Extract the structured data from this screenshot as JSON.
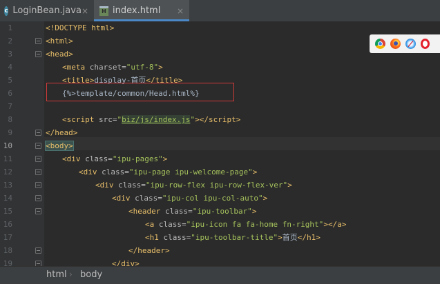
{
  "tabs": [
    {
      "label": "LoginBean.java",
      "icon": "java-class-icon",
      "active": false
    },
    {
      "label": "index.html",
      "icon": "html-file-icon",
      "active": true
    }
  ],
  "tab_close_glyph": "×",
  "editor": {
    "current_line": 10,
    "lines": [
      {
        "num": "1",
        "parts": [
          "<!DOCTYPE html>"
        ]
      },
      {
        "num": "2",
        "parts": [
          "<",
          "html",
          ">"
        ]
      },
      {
        "num": "3",
        "parts": [
          "<",
          "head",
          ">"
        ]
      },
      {
        "num": "4",
        "parts": [
          "<",
          "meta ",
          "charset=",
          "\"utf-8\"",
          ">"
        ]
      },
      {
        "num": "5",
        "parts": [
          "<",
          "title",
          ">",
          "display-首页",
          "</",
          "title",
          ">"
        ]
      },
      {
        "num": "6",
        "parts": [
          "{%>template/common/Head.html%}"
        ]
      },
      {
        "num": "7",
        "parts": [
          ""
        ]
      },
      {
        "num": "8",
        "parts": [
          "<",
          "script ",
          "src=",
          "\"",
          "biz/js/index.js",
          "\"",
          ">",
          "</",
          "script",
          ">"
        ]
      },
      {
        "num": "9",
        "parts": [
          "</",
          "head",
          ">"
        ]
      },
      {
        "num": "10",
        "parts": [
          "<",
          "body",
          ">"
        ]
      },
      {
        "num": "11",
        "parts": [
          "<",
          "div ",
          "class=",
          "\"ipu-pages\"",
          ">"
        ]
      },
      {
        "num": "12",
        "parts": [
          "<",
          "div ",
          "class=",
          "\"ipu-page ipu-welcome-page\"",
          ">"
        ]
      },
      {
        "num": "13",
        "parts": [
          "<",
          "div ",
          "class=",
          "\"ipu-row-flex ipu-row-flex-ver\"",
          ">"
        ]
      },
      {
        "num": "14",
        "parts": [
          "<",
          "div ",
          "class=",
          "\"ipu-col ipu-col-auto\"",
          ">"
        ]
      },
      {
        "num": "15",
        "parts": [
          "<",
          "header ",
          "class=",
          "\"ipu-toolbar\"",
          ">"
        ]
      },
      {
        "num": "16",
        "parts": [
          "<",
          "a ",
          "class=",
          "\"ipu-icon fa fa-home fn-right\"",
          ">",
          "</",
          "a",
          ">"
        ]
      },
      {
        "num": "17",
        "parts": [
          "<",
          "h1 ",
          "class=",
          "\"ipu-toolbar-title\"",
          ">",
          "首页",
          "</",
          "h1",
          ">"
        ]
      },
      {
        "num": "18",
        "parts": [
          "</",
          "header",
          ">"
        ]
      },
      {
        "num": "19",
        "parts": [
          "</",
          "div",
          ">"
        ]
      }
    ]
  },
  "browser_icons": [
    "chrome-icon",
    "firefox-icon",
    "safari-icon",
    "opera-icon"
  ],
  "breadcrumb": {
    "items": [
      "html",
      "body"
    ],
    "separator": "›"
  },
  "colors": {
    "background": "#2b2b2b",
    "tag": "#e8bf6a",
    "attribute": "#bababa",
    "attribute_value": "#a5c25c",
    "text": "#a9b7c6",
    "highlight_box": "#d23a3a",
    "active_tab_underline": "#4a88c7"
  }
}
